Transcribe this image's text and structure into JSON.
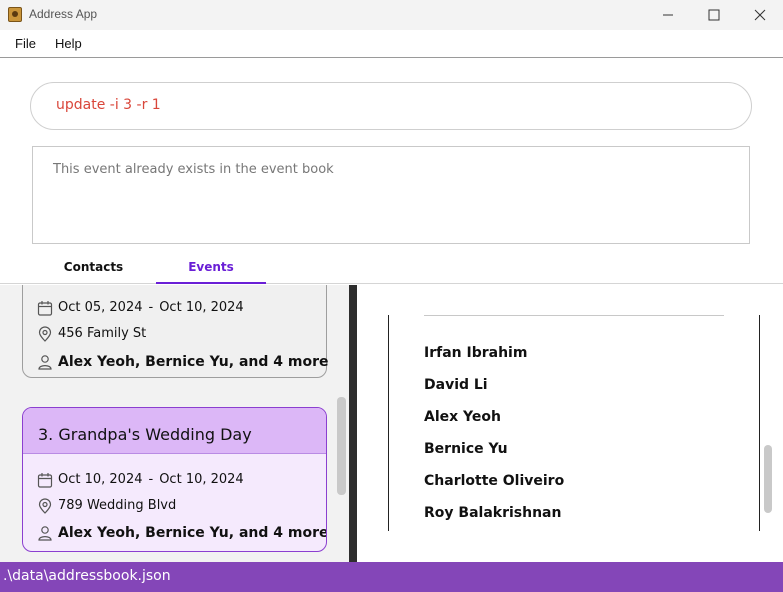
{
  "window": {
    "title": "Address App"
  },
  "menu": {
    "file": "File",
    "help": "Help"
  },
  "command": {
    "value": "update -i 3 -r 1"
  },
  "result": {
    "message": "This event already exists in the event book"
  },
  "tabs": [
    {
      "label": "Contacts",
      "active": false
    },
    {
      "label": "Events",
      "active": true
    }
  ],
  "events": [
    {
      "title": "",
      "date_start": "Oct 05, 2024",
      "date_end": "Oct 10, 2024",
      "location": "456 Family St",
      "people": "Alex Yeoh, Bernice Yu, and 4 more"
    },
    {
      "title": "3. Grandpa's Wedding Day",
      "date_start": "Oct 10, 2024",
      "date_end": "Oct 10, 2024",
      "location": "789 Wedding Blvd",
      "people": "Alex Yeoh, Bernice Yu, and 4 more",
      "selected": true
    }
  ],
  "event_detail": {
    "attendees": [
      "Irfan Ibrahim",
      "David Li",
      "Alex Yeoh",
      "Bernice Yu",
      "Charlotte Oliveiro",
      "Roy Balakrishnan"
    ]
  },
  "statusbar": {
    "path": ".\\data\\addressbook.json"
  },
  "colors": {
    "accent": "#6a1fd6",
    "statusbar": "#8446b8",
    "selected_card_header": "#dcb7f7",
    "selected_card_body": "#f5eafd",
    "command_text": "#d9463a"
  },
  "icons": {
    "date": "calendar-icon",
    "location": "location-pin-icon",
    "people": "person-icon"
  }
}
